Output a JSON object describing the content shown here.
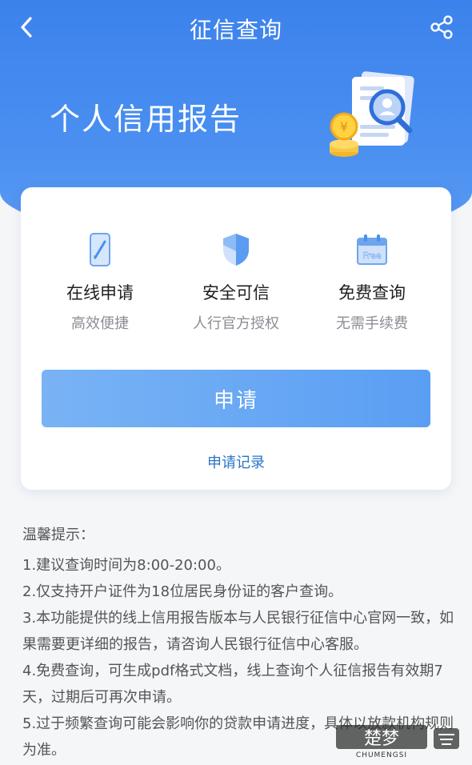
{
  "nav": {
    "title": "征信查询"
  },
  "hero": {
    "heading": "个人信用报告"
  },
  "features": [
    {
      "icon": "phone-edit-icon",
      "title": "在线申请",
      "subtitle": "高效便捷"
    },
    {
      "icon": "shield-icon",
      "title": "安全可信",
      "subtitle": "人行官方授权"
    },
    {
      "icon": "free-calendar-icon",
      "title": "免费查询",
      "subtitle": "无需手续费",
      "badge": "Free"
    }
  ],
  "actions": {
    "apply_label": "申请",
    "records_label": "申请记录"
  },
  "tips": {
    "heading": "温馨提示：",
    "items": [
      "1.建议查询时间为8:00-20:00。",
      "2.仅支持开户证件为18位居民身份证的客户查询。",
      "3.本功能提供的线上信用报告版本与人民银行征信中心官网一致，如果需要更详细的报告，请咨询人民银行征信中心客服。",
      "4.免费查询，可生成pdf格式文档，线上查询个人征信报告有效期7天，过期后可再次申请。",
      "5.过于频繁查询可能会影响你的贷款申请进度，具体以放款机构规则为准。"
    ]
  },
  "watermark": {
    "logo_text": "楚梦",
    "brand": "CHUMENGSI"
  },
  "colors": {
    "primary": "#3c82ec",
    "button": "#5a9ef3",
    "link": "#2b74c8"
  }
}
